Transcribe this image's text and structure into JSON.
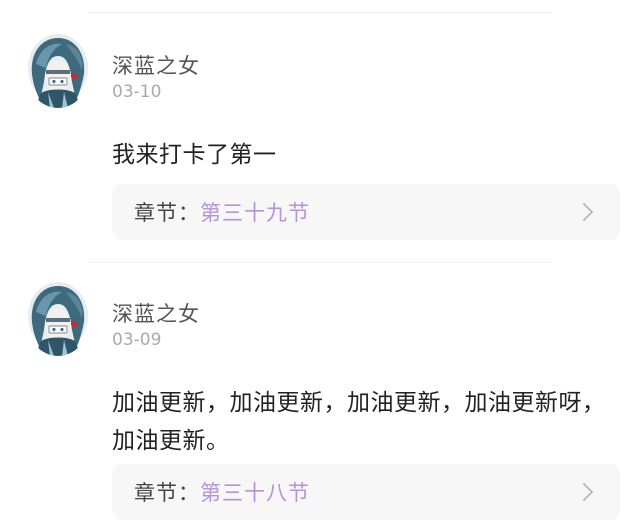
{
  "comments": [
    {
      "username": "深蓝之女",
      "date": "03-10",
      "content": "我来打卡了第一",
      "chapter_prefix": "章节：",
      "chapter_title": "第三十九节"
    },
    {
      "username": "深蓝之女",
      "date": "03-09",
      "content": "加油更新，加油更新，加油更新，加油更新呀，加油更新。",
      "chapter_prefix": "章节：",
      "chapter_title": "第三十八节"
    }
  ],
  "colors": {
    "chapter_accent": "#b693d8",
    "username": "#555555",
    "date": "#aaaaaa",
    "chapter_bg": "#f7f7f7"
  },
  "icons": {
    "chapter_arrow": "chevron-right-icon",
    "avatar": "user-avatar"
  }
}
